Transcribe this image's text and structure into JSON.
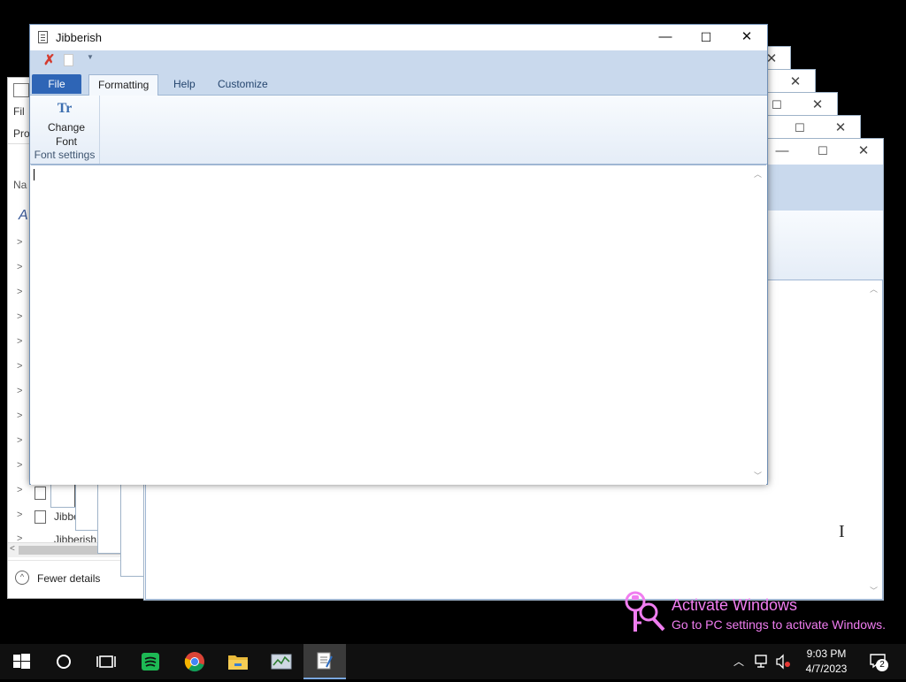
{
  "task_manager": {
    "menu_partial": "Fil",
    "tab_partial": "Pro",
    "column_partial": "Na",
    "section_partial": "A",
    "items": [
      "Jibberish",
      "Jibberish"
    ],
    "fewer_details": "Fewer details"
  },
  "window": {
    "title": "Jibberish",
    "minimize_glyph": "—",
    "maximize_glyph": "☐",
    "close_glyph": "✕"
  },
  "ribbon": {
    "tabs": [
      {
        "label": "File"
      },
      {
        "label": "Formatting"
      },
      {
        "label": "Help"
      },
      {
        "label": "Customize"
      }
    ],
    "change_font_line1": "Change",
    "change_font_line2": "Font",
    "group_label": "Font settings"
  },
  "editor": {
    "text": ""
  },
  "watermark": {
    "title": "Activate Windows",
    "subtitle": "Go to PC settings to activate Windows."
  },
  "taskbar": {
    "time": "9:03 PM",
    "date": "4/7/2023",
    "notification_count": "2",
    "active_app": "Jibberish"
  },
  "colors": {
    "file_tab": "#2e65b6",
    "ribbon_bg": "#c9d9ed",
    "watermark": "#f07df0",
    "taskbar": "#101010"
  }
}
